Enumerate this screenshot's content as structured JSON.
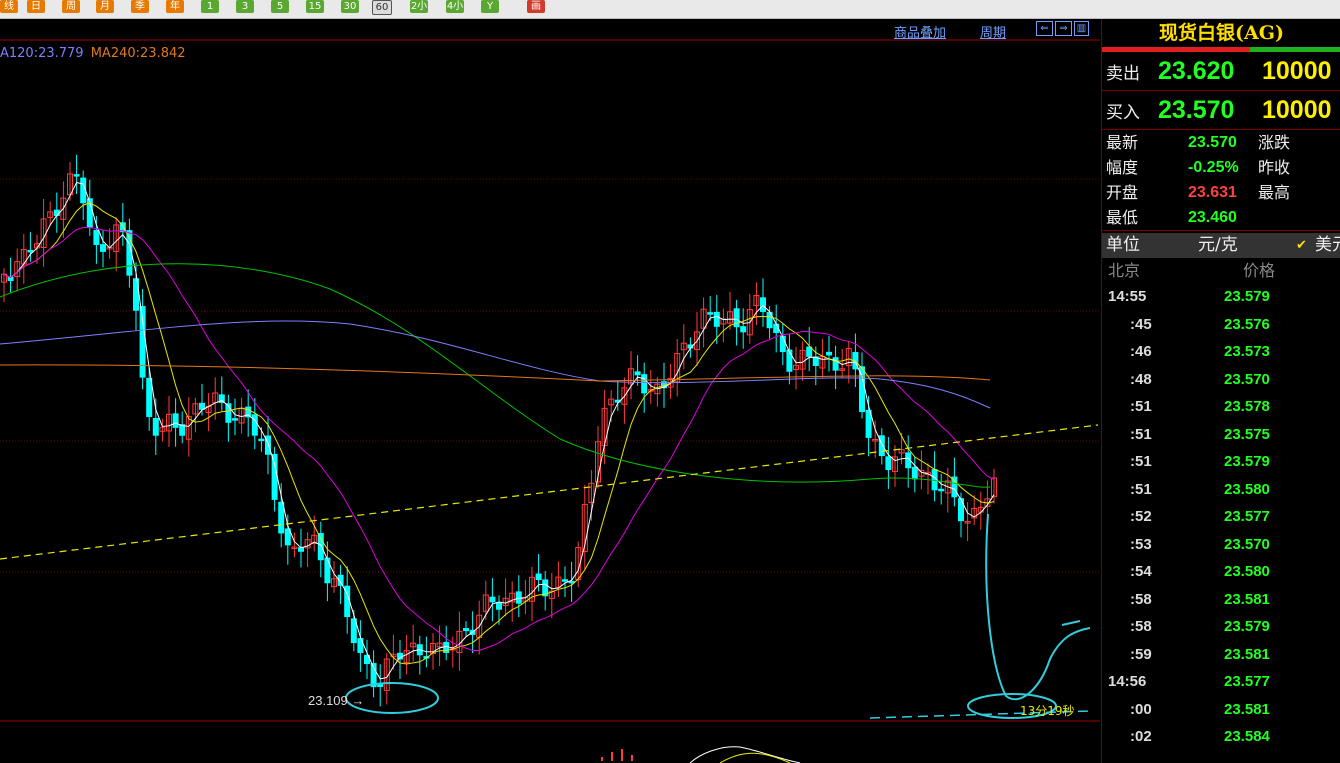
{
  "toolbar": {
    "buttons": [
      {
        "label": "线",
        "color": "#e67a00"
      },
      {
        "label": "日",
        "color": "#e67a00"
      },
      {
        "label": "周",
        "color": "#e67a00"
      },
      {
        "label": "月",
        "color": "#e67a00"
      },
      {
        "label": "季",
        "color": "#e67a00"
      },
      {
        "label": "年",
        "color": "#e67a00"
      },
      {
        "label": "1",
        "color": "#5aa832"
      },
      {
        "label": "3",
        "color": "#5aa832"
      },
      {
        "label": "5",
        "color": "#5aa832"
      },
      {
        "label": "15",
        "color": "#5aa832"
      },
      {
        "label": "30",
        "color": "#5aa832"
      },
      {
        "label": "60",
        "color": "#5aa832",
        "selected": true
      },
      {
        "label": "2小",
        "color": "#5aa832"
      },
      {
        "label": "4小",
        "color": "#5aa832"
      },
      {
        "label": "Y",
        "color": "#5aa832"
      },
      {
        "label": "画",
        "color": "#d23a2a"
      }
    ]
  },
  "chart": {
    "links": {
      "overlay": "商品叠加",
      "period": "周期"
    },
    "ma_legend": [
      {
        "text": "A120:23.779",
        "color": "#7f7fff"
      },
      {
        "text": "MA240:23.842",
        "color": "#e0781a"
      }
    ],
    "low_marker": "23.109",
    "countdown": "13分19秒",
    "colors": {
      "up": "#ff3b3b",
      "down": "#00ffff",
      "ma5": "#ffffff",
      "ma10": "#e8e800",
      "ma20": "#e000e0",
      "ma60": "#00c000",
      "ma120": "#7f7fff",
      "ma240": "#e0781a",
      "grid": "#700000",
      "trend": "#e8e800",
      "annotation": "#33ccdd"
    }
  },
  "chart_data": {
    "type": "candlestick",
    "instrument": "现货白银(AG)",
    "period": "60",
    "low_label": 23.109,
    "indicators": {
      "MA120": 23.779,
      "MA240": 23.842
    }
  },
  "panel": {
    "title": "现货白银(AG)",
    "sell": {
      "label": "卖出",
      "price": "23.620",
      "volume": "10000"
    },
    "buy": {
      "label": "买入",
      "price": "23.570",
      "volume": "10000"
    },
    "stats": {
      "latest_label": "最新",
      "latest": "23.570",
      "change_label": "涨跌",
      "range_label": "幅度",
      "range": "-0.25%",
      "prev_label": "昨收",
      "open_label": "开盘",
      "open": "23.631",
      "high_label": "最高",
      "low_label": "最低",
      "low": "23.460"
    },
    "unit": {
      "label": "单位",
      "value": "元/克",
      "check": "✔",
      "currency": "美元"
    },
    "tick_header": {
      "place": "北京",
      "price": "价格"
    },
    "ticks": [
      {
        "time": "14:55",
        "price": "23.579",
        "main": true
      },
      {
        "time": ":45",
        "price": "23.576"
      },
      {
        "time": ":46",
        "price": "23.573"
      },
      {
        "time": ":48",
        "price": "23.570"
      },
      {
        "time": ":51",
        "price": "23.578"
      },
      {
        "time": ":51",
        "price": "23.575"
      },
      {
        "time": ":51",
        "price": "23.579"
      },
      {
        "time": ":51",
        "price": "23.580"
      },
      {
        "time": ":52",
        "price": "23.577"
      },
      {
        "time": ":53",
        "price": "23.570"
      },
      {
        "time": ":54",
        "price": "23.580"
      },
      {
        "time": ":58",
        "price": "23.581"
      },
      {
        "time": ":58",
        "price": "23.579"
      },
      {
        "time": ":59",
        "price": "23.581"
      },
      {
        "time": "14:56",
        "price": "23.577",
        "main": true
      },
      {
        "time": ":00",
        "price": "23.581"
      },
      {
        "time": ":02",
        "price": "23.584"
      }
    ]
  }
}
